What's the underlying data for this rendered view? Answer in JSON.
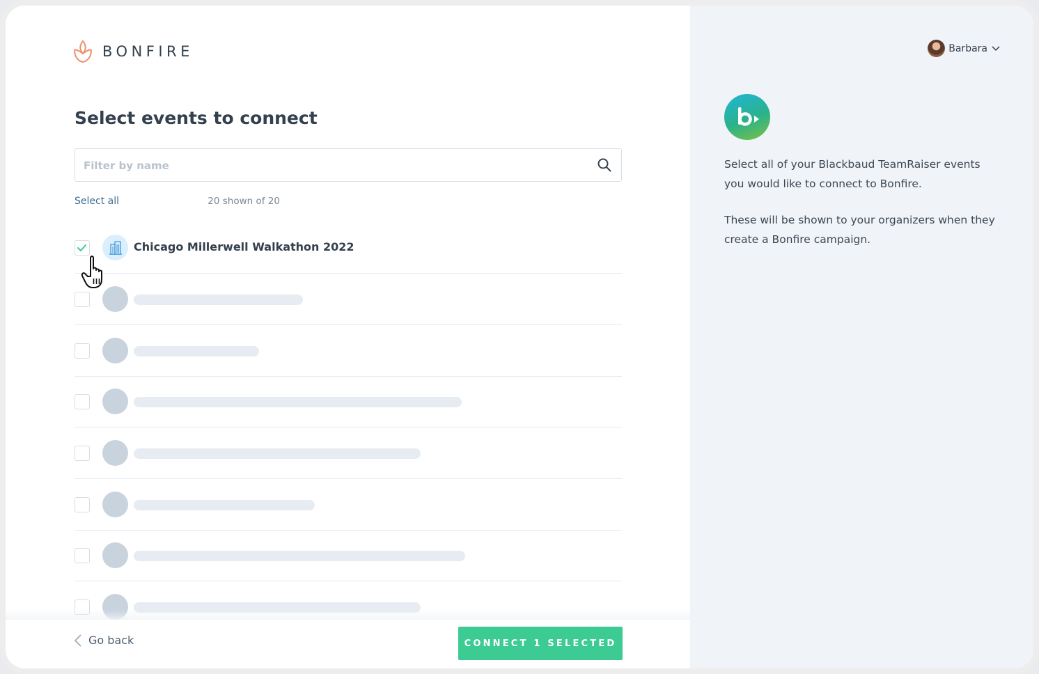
{
  "brand": {
    "name": "BONFIRE",
    "accent": "#ef8f6c"
  },
  "page": {
    "title": "Select events to connect"
  },
  "search": {
    "placeholder": "Filter by name",
    "value": ""
  },
  "list": {
    "select_all_label": "Select all",
    "count_label": "20 shown of 20",
    "items": [
      {
        "title": "Chicago Millerwell Walkathon 2022",
        "checked": true,
        "icon": "building-icon",
        "loaded": true
      },
      {
        "title": "",
        "checked": false,
        "loaded": false
      },
      {
        "title": "",
        "checked": false,
        "loaded": false
      },
      {
        "title": "",
        "checked": false,
        "loaded": false
      },
      {
        "title": "",
        "checked": false,
        "loaded": false
      },
      {
        "title": "",
        "checked": false,
        "loaded": false
      },
      {
        "title": "",
        "checked": false,
        "loaded": false
      },
      {
        "title": "",
        "checked": false,
        "loaded": false
      }
    ]
  },
  "footer": {
    "back_label": "Go back",
    "connect_label": "CONNECT 1 SELECTED",
    "connect_color": "#3ccb93"
  },
  "user": {
    "name": "Barbara"
  },
  "sidebar": {
    "integration_icon": "blackbaud-logo-icon",
    "paragraph_1": "Select all of your Blackbaud TeamRaiser events you would like to connect to Bonfire.",
    "paragraph_2": "These will be shown to your organizers when they create a Bonfire campaign."
  }
}
